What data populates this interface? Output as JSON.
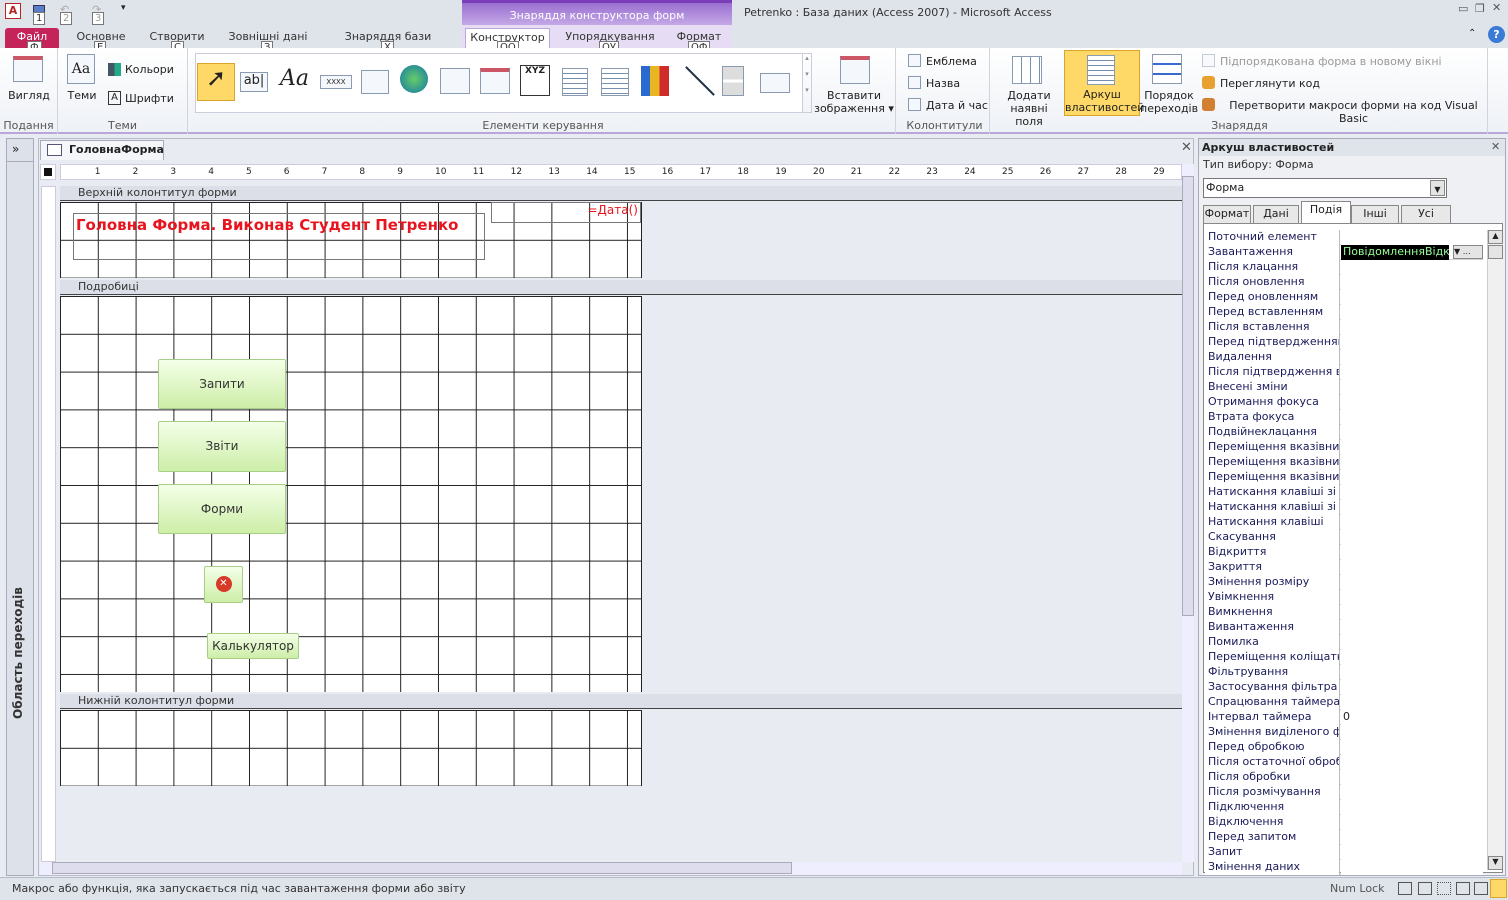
{
  "window": {
    "title": "Petrenko : База даних (Access 2007)  -  Microsoft Access",
    "context_header": "Знаряддя конструктора форм"
  },
  "qat": {
    "keys": [
      "1",
      "2",
      "3"
    ]
  },
  "tabs": [
    {
      "label": "Файл",
      "key": "Ф"
    },
    {
      "label": "Основне",
      "key": "Е"
    },
    {
      "label": "Створити",
      "key": "С"
    },
    {
      "label": "Зовнішні дані",
      "key": "З"
    },
    {
      "label": "Знаряддя бази даних",
      "key": "Х"
    },
    {
      "label": "Конструктор",
      "key": "ОО"
    },
    {
      "label": "Упорядкування",
      "key": "ОУ"
    },
    {
      "label": "Формат",
      "key": "ОФ"
    }
  ],
  "ribbon": {
    "view": {
      "label": "Вигляд",
      "group": "Подання"
    },
    "themes": {
      "themes": "Теми",
      "colors": "Кольори",
      "fonts": "Шрифти",
      "group": "Теми"
    },
    "controls": {
      "group": "Елементи керування",
      "textbox": "ab|",
      "label": "Aa",
      "xxxx": "XXXX",
      "xyz": "XYZ"
    },
    "insert_image": {
      "line1": "Вставити",
      "line2": "зображення"
    },
    "header_footer": {
      "logo": "Емблема",
      "title": "Назва",
      "datetime": "Дата й час",
      "group": "Колонтитули"
    },
    "tools": {
      "add_fields1": "Додати",
      "add_fields2": "наявні поля",
      "sheet1": "Аркуш",
      "sheet2": "властивостей",
      "order1": "Порядок",
      "order2": "переходів",
      "subform": "Підпорядкована форма в новому вікні",
      "view_code": "Переглянути код",
      "convert": "Перетворити макроси форми на код Visual Basic",
      "group": "Знаряддя"
    }
  },
  "nav": {
    "label": "Область переходів",
    "toggle": "»"
  },
  "document": {
    "tab": "ГоловнаФорма",
    "ruler_top": [
      "1",
      "2",
      "3",
      "4",
      "5",
      "6",
      "7",
      "8",
      "9",
      "10",
      "11",
      "12",
      "13",
      "14",
      "15",
      "16",
      "17",
      "18",
      "19",
      "20",
      "21",
      "22",
      "23",
      "24",
      "25",
      "26",
      "27",
      "28",
      "29"
    ],
    "sections": {
      "header": "Верхній колонтитул форми",
      "detail": "Подробиці",
      "footer": "Нижній колонтитул форми"
    },
    "header_title": "Головна Форма. Виконав Студент Петренко",
    "date_field": "=Дата()",
    "buttons": {
      "queries": "Запити",
      "reports": "Звіти",
      "forms": "Форми",
      "calculator": "Калькулятор"
    }
  },
  "property_sheet": {
    "title": "Аркуш властивостей",
    "selection_type_label": "Тип вибору:",
    "selection_type": "Форма",
    "selector": "Форма",
    "tabs": [
      "Формат",
      "Дані",
      "Подія",
      "Інші",
      "Усі"
    ],
    "active_tab": "Подія",
    "rows": [
      {
        "label": "Поточний елемент",
        "value": ""
      },
      {
        "label": "Завантаження",
        "value": "ПовідомленняВідкр"
      },
      {
        "label": "Після клацання",
        "value": ""
      },
      {
        "label": "Після оновлення",
        "value": ""
      },
      {
        "label": "Перед оновленням",
        "value": ""
      },
      {
        "label": "Перед вставленням",
        "value": ""
      },
      {
        "label": "Після вставлення",
        "value": ""
      },
      {
        "label": "Перед підтвердженням",
        "value": ""
      },
      {
        "label": "Видалення",
        "value": ""
      },
      {
        "label": "Після підтвердження ви",
        "value": ""
      },
      {
        "label": "Внесені зміни",
        "value": ""
      },
      {
        "label": "Отримання фокуса",
        "value": ""
      },
      {
        "label": "Втрата фокуса",
        "value": ""
      },
      {
        "label": "Подвійнеклацання",
        "value": ""
      },
      {
        "label": "Переміщення вказівник",
        "value": ""
      },
      {
        "label": "Переміщення вказівник",
        "value": ""
      },
      {
        "label": "Переміщення вказівник",
        "value": ""
      },
      {
        "label": "Натискання клавіші зі сп",
        "value": ""
      },
      {
        "label": "Натискання клавіші зі сп",
        "value": ""
      },
      {
        "label": "Натискання клавіші",
        "value": ""
      },
      {
        "label": "Скасування",
        "value": ""
      },
      {
        "label": "Відкриття",
        "value": ""
      },
      {
        "label": "Закриття",
        "value": ""
      },
      {
        "label": "Змінення розміру",
        "value": ""
      },
      {
        "label": "Увімкнення",
        "value": ""
      },
      {
        "label": "Вимкнення",
        "value": ""
      },
      {
        "label": "Вивантаження",
        "value": ""
      },
      {
        "label": "Помилка",
        "value": ""
      },
      {
        "label": "Переміщення коліщатка",
        "value": ""
      },
      {
        "label": "Фільтрування",
        "value": ""
      },
      {
        "label": "Застосування фільтра",
        "value": ""
      },
      {
        "label": "Спрацювання таймера",
        "value": ""
      },
      {
        "label": "Інтервал таймера",
        "value": "0"
      },
      {
        "label": "Змінення виділеного фр",
        "value": ""
      },
      {
        "label": "Перед обробкою",
        "value": ""
      },
      {
        "label": "Після остаточної оброб",
        "value": ""
      },
      {
        "label": "Після обробки",
        "value": ""
      },
      {
        "label": "Після розмічування",
        "value": ""
      },
      {
        "label": "Підключення",
        "value": ""
      },
      {
        "label": "Відключення",
        "value": ""
      },
      {
        "label": "Перед запитом",
        "value": ""
      },
      {
        "label": "Запит",
        "value": ""
      },
      {
        "label": "Змінення даних",
        "value": ""
      }
    ]
  },
  "status": {
    "message": "Макрос або функція, яка запускається під час завантаження форми або звіту",
    "numlock": "Num Lock"
  }
}
